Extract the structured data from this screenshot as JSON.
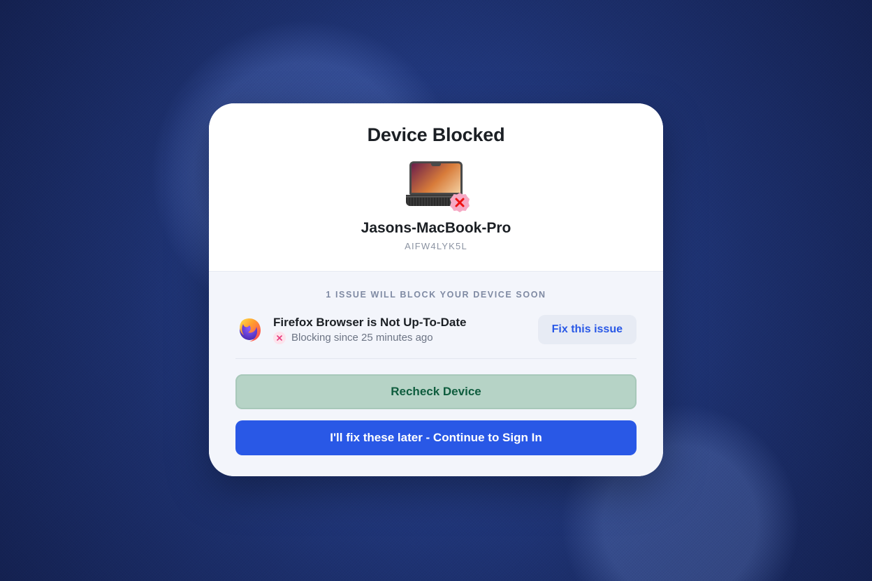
{
  "header": {
    "title": "Device Blocked",
    "device_name": "Jasons-MacBook-Pro",
    "device_id": "AIFW4LYK5L"
  },
  "issues": {
    "banner": "1 ISSUE WILL BLOCK YOUR DEVICE SOON",
    "items": [
      {
        "icon": "firefox-icon",
        "title": "Firefox Browser is Not Up-To-Date",
        "status": "Blocking since 25 minutes ago",
        "fix_label": "Fix this issue"
      }
    ]
  },
  "actions": {
    "recheck_label": "Recheck Device",
    "continue_label": "I'll fix these later - Continue to Sign In"
  },
  "colors": {
    "accent_blue": "#2958e6",
    "danger_pink": "#e73c7e",
    "muted_green": "#b6d3c6"
  }
}
